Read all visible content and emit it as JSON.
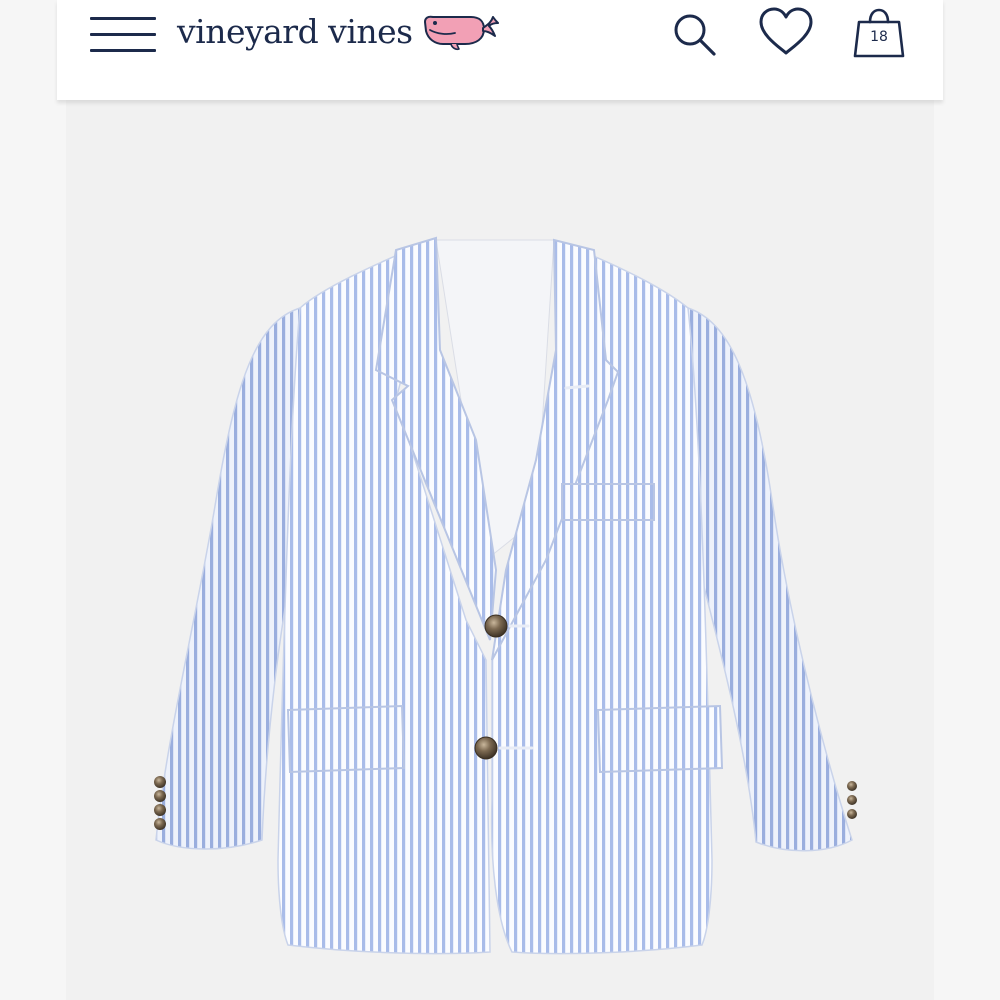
{
  "header": {
    "brand_name": "vineyard vines",
    "cart": {
      "count": "18"
    }
  },
  "icons": {
    "menu": "hamburger-menu-icon",
    "logo": "whale-logo-icon",
    "search": "search-icon",
    "wishlist": "heart-icon",
    "cart": "shopping-bag-icon"
  },
  "colors": {
    "navy": "#1c2a4b",
    "whale_pink": "#f2a0b5",
    "background": "#f6f6f6",
    "jacket_stripe_blue": "#9fb4e6"
  }
}
